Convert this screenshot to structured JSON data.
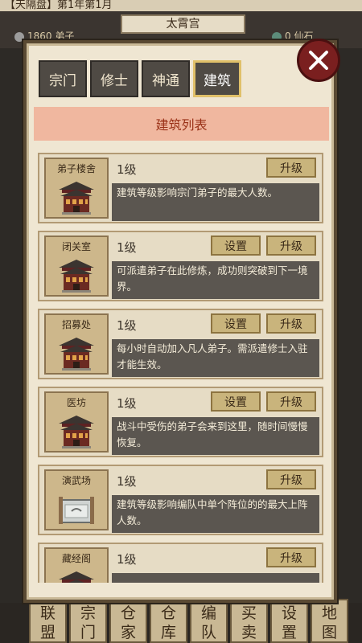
{
  "background": {
    "topbar_text": "【天隔盘】第1年第1月",
    "location": "太霄宫",
    "stat_left": "1860 弟子",
    "stat_right": "0 仙石",
    "bottom_nav": [
      {
        "top": "联",
        "bottom": "盟"
      },
      {
        "top": "宗",
        "bottom": "门"
      },
      {
        "top": "仓",
        "bottom": "家"
      },
      {
        "top": "仓",
        "bottom": "库"
      },
      {
        "top": "编",
        "bottom": "队"
      },
      {
        "top": "买",
        "bottom": "卖"
      },
      {
        "top": "设",
        "bottom": "置"
      },
      {
        "top": "地",
        "bottom": "图"
      }
    ]
  },
  "panel": {
    "close_icon": "close-icon",
    "tabs": [
      {
        "label": "宗门",
        "active": false
      },
      {
        "label": "修士",
        "active": false
      },
      {
        "label": "神通",
        "active": false
      },
      {
        "label": "建筑",
        "active": true
      }
    ],
    "list_title": "建筑列表",
    "buildings": [
      {
        "name": "弟子楼舍",
        "level": "1级",
        "setup_label": "",
        "upgrade_label": "升级",
        "desc": "建筑等级影响宗门弟子的最大人数。"
      },
      {
        "name": "闭关室",
        "level": "1级",
        "setup_label": "设置",
        "upgrade_label": "升级",
        "desc": "可派遣弟子在此修炼，成功则突破到下一境界。"
      },
      {
        "name": "招募处",
        "level": "1级",
        "setup_label": "设置",
        "upgrade_label": "升级",
        "desc": "每小时自动加入凡人弟子。需派遣修士入驻才能生效。"
      },
      {
        "name": "医坊",
        "level": "1级",
        "setup_label": "设置",
        "upgrade_label": "升级",
        "desc": "战斗中受伤的弟子会来到这里，随时间慢慢恢复。"
      },
      {
        "name": "演武场",
        "level": "1级",
        "setup_label": "",
        "upgrade_label": "升级",
        "desc": "建筑等级影响编队中单个阵位的的最大上阵人数。"
      },
      {
        "name": "藏经阁",
        "level": "1级",
        "setup_label": "",
        "upgrade_label": "升级",
        "desc": ""
      }
    ]
  },
  "colors": {
    "panel_bg": "#efe6d2",
    "header_bg": "#f0b79f",
    "header_text": "#9a3218",
    "tab_active_border": "#e0c069",
    "close_bg": "#7a1f1f"
  }
}
